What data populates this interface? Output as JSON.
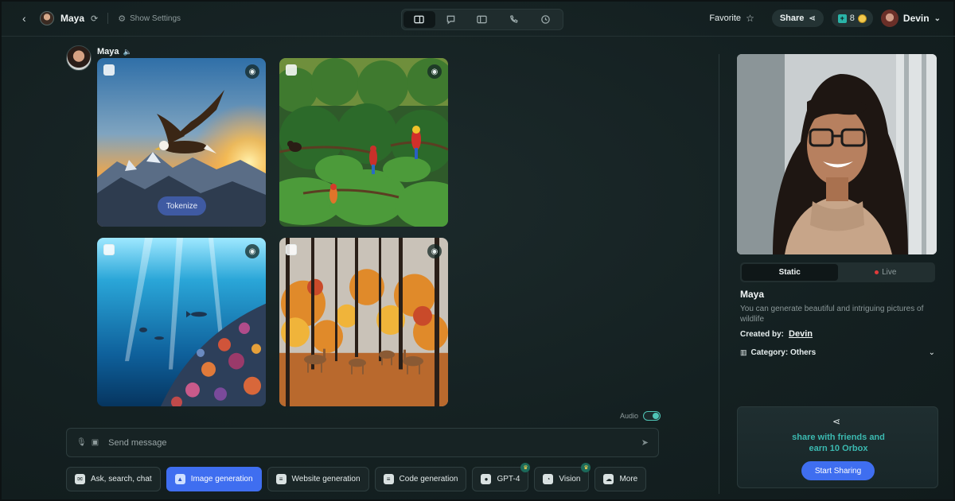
{
  "topbar": {
    "back_icon": "chevron-left-icon",
    "bot_name": "Maya",
    "refresh_icon": "refresh-icon",
    "settings_label": "Show Settings",
    "view_modes": [
      "split-view-icon",
      "chat-icon",
      "sidebar-icon",
      "phone-icon",
      "history-icon"
    ],
    "active_view": 0,
    "favorite_label": "Favorite",
    "share_label": "Share",
    "credits": "8",
    "user_name": "Devin"
  },
  "chat": {
    "bot_name": "Maya",
    "images": [
      {
        "scene": "eagle over mountains at sunset",
        "has_tokenize": true
      },
      {
        "scene": "jungle with parrots and monkeys",
        "has_tokenize": false
      },
      {
        "scene": "underwater coral reef with dolphins",
        "has_tokenize": false
      },
      {
        "scene": "autumn forest with deer",
        "has_tokenize": false
      }
    ],
    "tokenize_label": "Tokenize",
    "audio_label": "Audio",
    "audio_on": true,
    "input_placeholder": "Send message"
  },
  "modes": [
    {
      "label": "Ask, search, chat",
      "icon": "chat-bubble-icon",
      "active": false,
      "premium": false
    },
    {
      "label": "Image generation",
      "icon": "image-icon",
      "active": true,
      "premium": false
    },
    {
      "label": "Website generation",
      "icon": "document-icon",
      "active": false,
      "premium": false
    },
    {
      "label": "Code generation",
      "icon": "code-file-icon",
      "active": false,
      "premium": false
    },
    {
      "label": "GPT-4",
      "icon": "gpt-icon",
      "active": false,
      "premium": true
    },
    {
      "label": "Vision",
      "icon": "eyes-icon",
      "active": false,
      "premium": true
    },
    {
      "label": "More",
      "icon": "more-icon",
      "active": false,
      "premium": false
    }
  ],
  "profile": {
    "tabs": [
      "Static",
      "Live"
    ],
    "active_tab": 0,
    "name": "Maya",
    "description": "You can generate beautiful and intriguing pictures of wildlife",
    "created_by_label": "Created by:",
    "creator": "Devin",
    "category_label": "Category: Others"
  },
  "promo": {
    "line1": "share with friends and",
    "line2": "earn 10 Orbox",
    "button_label": "Start Sharing"
  },
  "colors": {
    "background": "#152021",
    "accent": "#3f6ef0",
    "teal": "#3bb9b0"
  }
}
